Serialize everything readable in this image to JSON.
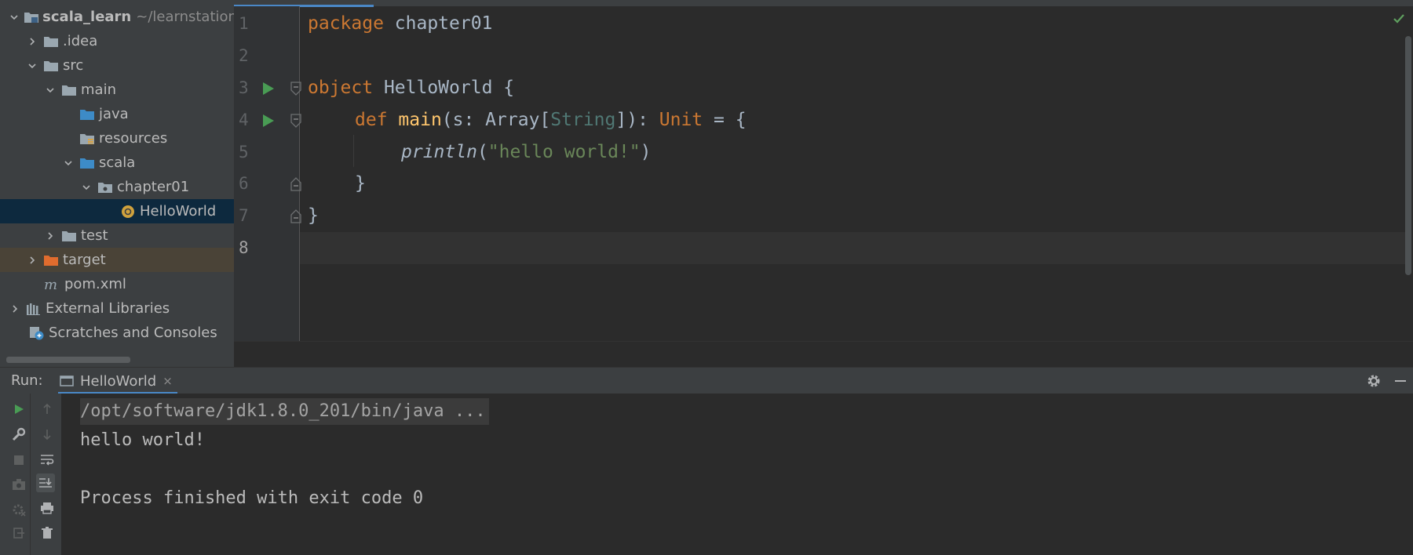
{
  "project": {
    "root_name": "scala_learn",
    "root_path": "~/learnstation/",
    "items": [
      {
        "label": "scala_learn",
        "level": 0,
        "icon": "module-folder-icon",
        "expanded": true
      },
      {
        "label": ".idea",
        "level": 1,
        "icon": "folder-icon",
        "expanded": false
      },
      {
        "label": "src",
        "level": 1,
        "icon": "folder-icon",
        "expanded": true
      },
      {
        "label": "main",
        "level": 2,
        "icon": "folder-icon",
        "expanded": true
      },
      {
        "label": "java",
        "level": 3,
        "icon": "source-folder-icon"
      },
      {
        "label": "resources",
        "level": 3,
        "icon": "resources-folder-icon"
      },
      {
        "label": "scala",
        "level": 3,
        "icon": "source-folder-icon",
        "expanded": true
      },
      {
        "label": "chapter01",
        "level": 4,
        "icon": "package-icon",
        "expanded": true
      },
      {
        "label": "HelloWorld",
        "level": 5,
        "icon": "scala-object-icon",
        "selected": true
      },
      {
        "label": "test",
        "level": 2,
        "icon": "folder-icon",
        "expanded": false
      },
      {
        "label": "target",
        "level": 1,
        "icon": "excluded-folder-icon",
        "expanded": false
      },
      {
        "label": "pom.xml",
        "level": 1,
        "icon": "maven-icon"
      },
      {
        "label": "External Libraries",
        "level": 0,
        "icon": "libraries-icon",
        "expanded": false
      },
      {
        "label": "Scratches and Consoles",
        "level": 0,
        "icon": "scratches-icon"
      }
    ]
  },
  "editor": {
    "line_numbers": [
      "1",
      "2",
      "3",
      "4",
      "5",
      "6",
      "7",
      "8"
    ],
    "code": {
      "l1_kw": "package",
      "l1_name": " chapter01",
      "l3_kw": "object",
      "l3_rest": " HelloWorld {",
      "l4_kw": "def",
      "l4_fn": "main",
      "l4_a": "(s: Array[",
      "l4_type": "String",
      "l4_b": "]): ",
      "l4_unit": "Unit",
      "l4_c": " = {",
      "l5_fn": "println",
      "l5_a": "(",
      "l5_str": "\"hello world!\"",
      "l5_b": ")",
      "l6": "}",
      "l7": "}"
    }
  },
  "run_panel": {
    "label": "Run:",
    "tab_label": "HelloWorld",
    "tab_close": "×",
    "console_lines": [
      "/opt/software/jdk1.8.0_201/bin/java ...",
      "hello world!",
      "",
      "Process finished with exit code 0"
    ]
  },
  "colors": {
    "keyword": "#cc7832",
    "function": "#ffc66d",
    "string": "#6a8759",
    "type": "#507874",
    "run_green": "#499c54",
    "selection": "#0d293e"
  }
}
